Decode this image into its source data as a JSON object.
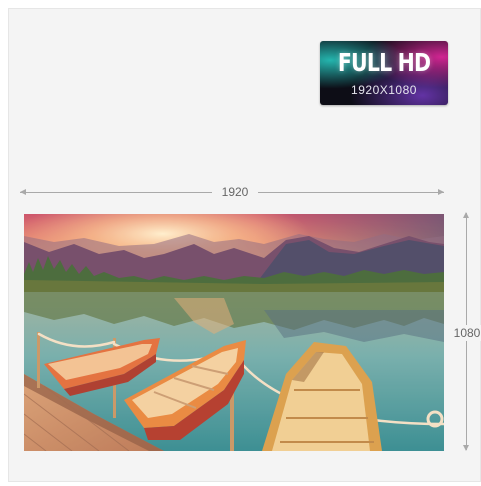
{
  "badge": {
    "title": "FULL HD",
    "resolution": "1920X1080"
  },
  "dimensions": {
    "width_label": "1920",
    "height_label": "1080"
  },
  "colors": {
    "panel_background": "#f4f4f4",
    "dimension_line": "#a9a9a9",
    "label_text": "#666666"
  },
  "icons": {
    "arrows": "dimension-arrow-icon"
  }
}
